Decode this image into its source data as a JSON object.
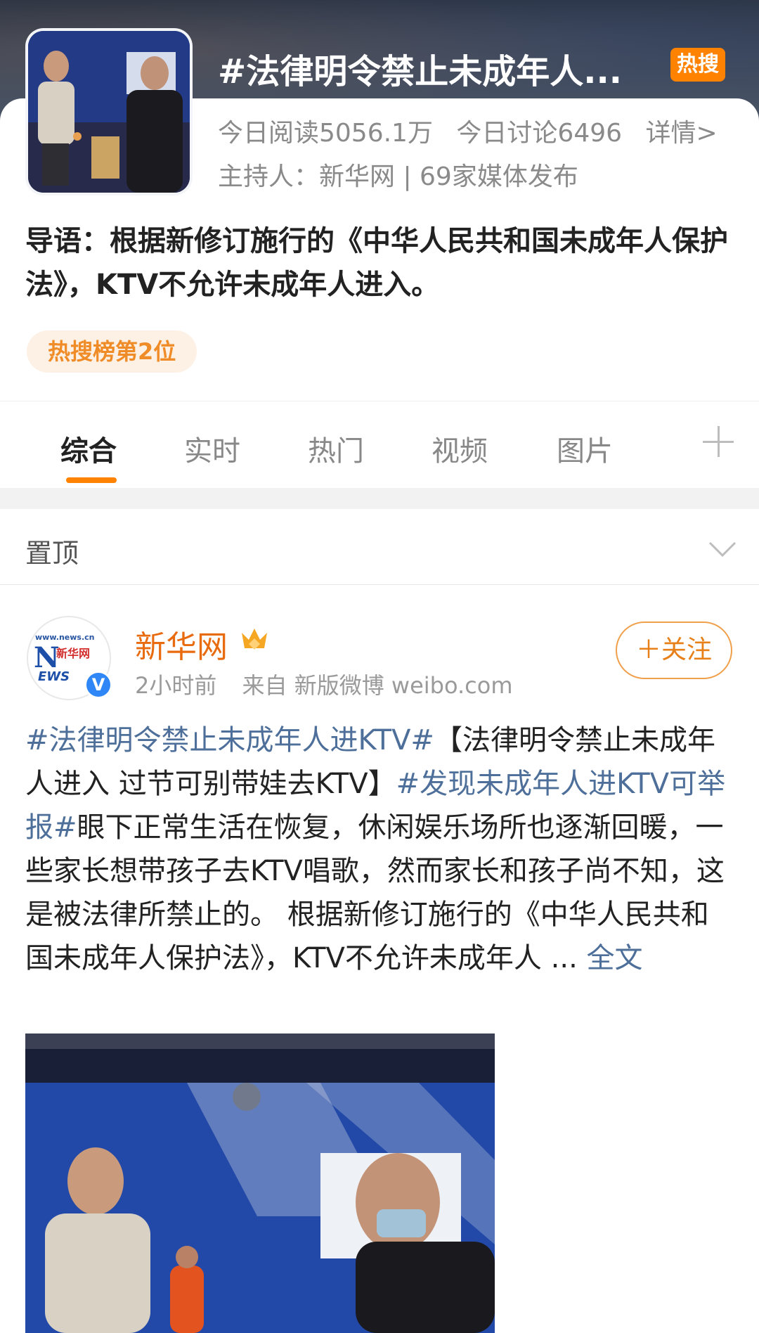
{
  "header": {
    "topic_title": "#法律明令禁止未成年人...",
    "hot_badge": "热搜",
    "stats": {
      "read": "今日阅读5056.1万",
      "discuss": "今日讨论6496",
      "details": "详情>"
    },
    "host": "主持人：新华网 | 69家媒体发布",
    "intro": "导语：根据新修订施行的《中华人民共和国未成年人保护法》，KTV不允许未成年人进入。",
    "rank_label": "热搜榜第2位"
  },
  "tabs": [
    {
      "label": "综合",
      "active": true
    },
    {
      "label": "实时",
      "active": false
    },
    {
      "label": "热门",
      "active": false
    },
    {
      "label": "视频",
      "active": false
    },
    {
      "label": "图片",
      "active": false
    }
  ],
  "pinned": {
    "label": "置顶"
  },
  "post": {
    "author": "新华网",
    "avatar_text": {
      "top": "www.news.cn",
      "big": "N",
      "cn": "新华网",
      "ews": "EWS"
    },
    "time": "2小时前",
    "source": "来自 新版微博 weibo.com",
    "follow_label": "＋关注",
    "segments": [
      {
        "type": "tag",
        "text": "#法律明令禁止未成年人进KTV#"
      },
      {
        "type": "text",
        "text": "【法律明令禁止未成年人进入 过节可别带娃去KTV】"
      },
      {
        "type": "tag",
        "text": "#发现未成年人进KTV可举报#"
      },
      {
        "type": "text",
        "text": "眼下正常生活在恢复，休闲娱乐场所也逐渐回暖，一些家长想带孩子去KTV唱歌，然而家长和孩子尚不知，这是被法律所禁止的。 根据新修订施行的《中华人民共和国未成年人保护法》，KTV不允许未成年人 ... "
      },
      {
        "type": "more",
        "text": "全文"
      }
    ]
  },
  "colors": {
    "accent": "#ff8200",
    "link": "#4d6f9a",
    "author": "#e86b10"
  }
}
